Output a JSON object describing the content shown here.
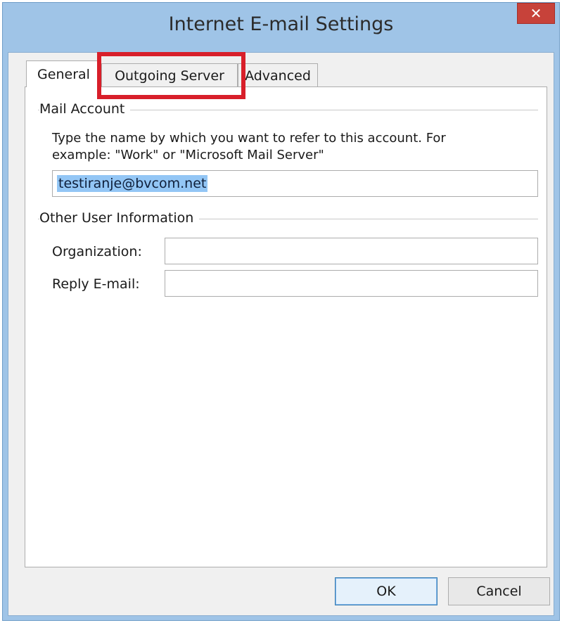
{
  "window": {
    "title": "Internet E-mail Settings",
    "close_label": "✕"
  },
  "tabs": [
    {
      "label": "General",
      "active": true
    },
    {
      "label": "Outgoing Server",
      "active": false,
      "highlighted": true
    },
    {
      "label": "Advanced",
      "active": false
    }
  ],
  "mail_account": {
    "heading": "Mail Account",
    "description_line1": "Type the name by which you want to refer to this account. For",
    "description_line2": "example: \"Work\" or \"Microsoft Mail Server\"",
    "account_name_value": "testiranje@bvcom.net"
  },
  "other_user_info": {
    "heading": "Other User Information",
    "organization_label": "Organization:",
    "organization_value": "",
    "reply_email_label": "Reply E-mail:",
    "reply_email_value": ""
  },
  "buttons": {
    "ok_label": "OK",
    "cancel_label": "Cancel"
  },
  "colors": {
    "window_frame": "#9fc4e7",
    "close_button": "#c7423a",
    "highlight_box": "#d81f2a",
    "selection": "#93c6f5"
  }
}
